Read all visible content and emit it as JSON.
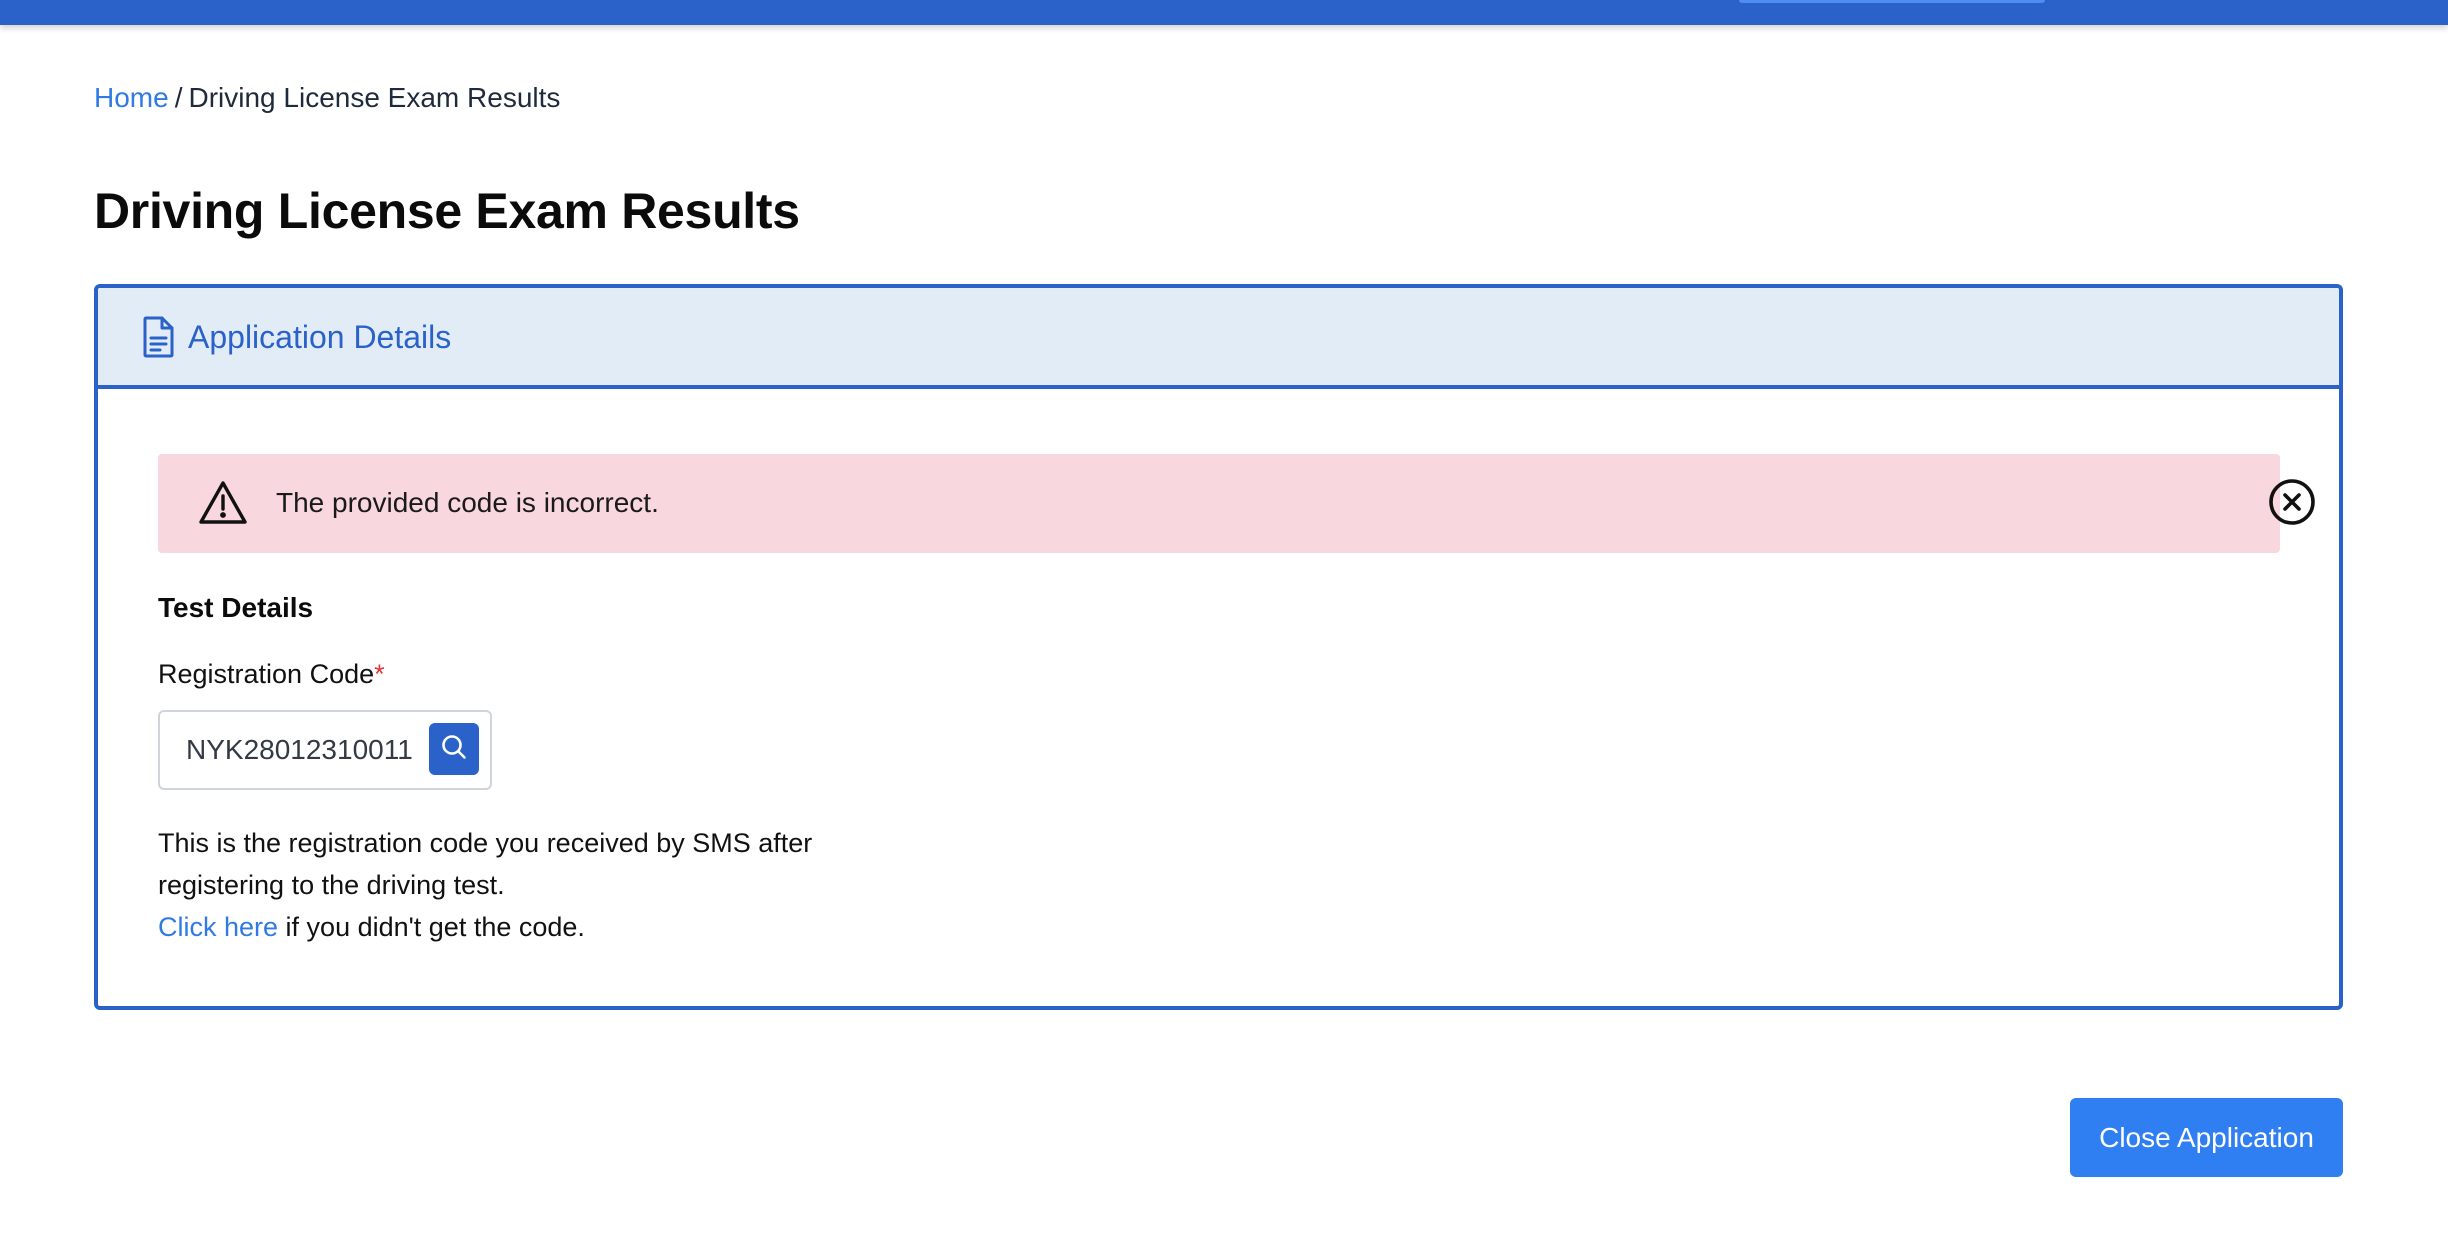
{
  "breadcrumb": {
    "home": "Home",
    "separator": "/",
    "current": "Driving License Exam Results"
  },
  "page": {
    "title": "Driving License Exam Results"
  },
  "panel": {
    "header_title": "Application Details",
    "header_icon": "document-icon"
  },
  "alert": {
    "message": "The provided code is incorrect.",
    "icon": "warning-triangle-icon",
    "close_icon": "close-circle-icon"
  },
  "form": {
    "section_title": "Test Details",
    "registration_label": "Registration Code",
    "required_marker": "*",
    "registration_value": "NYK28012310011",
    "search_icon": "search-icon"
  },
  "help": {
    "line1": "This is the registration code you received by SMS after registering to the driving test.",
    "link_text": "Click here",
    "link_suffix": " if you didn't get the code."
  },
  "actions": {
    "close_application": "Close Application"
  },
  "colors": {
    "primary": "#2a62c9",
    "button": "#2f7ef2",
    "alert_bg": "#f8d7de",
    "header_bg": "#e2ecf7",
    "link": "#2f7ae5",
    "required": "#e0353d"
  }
}
